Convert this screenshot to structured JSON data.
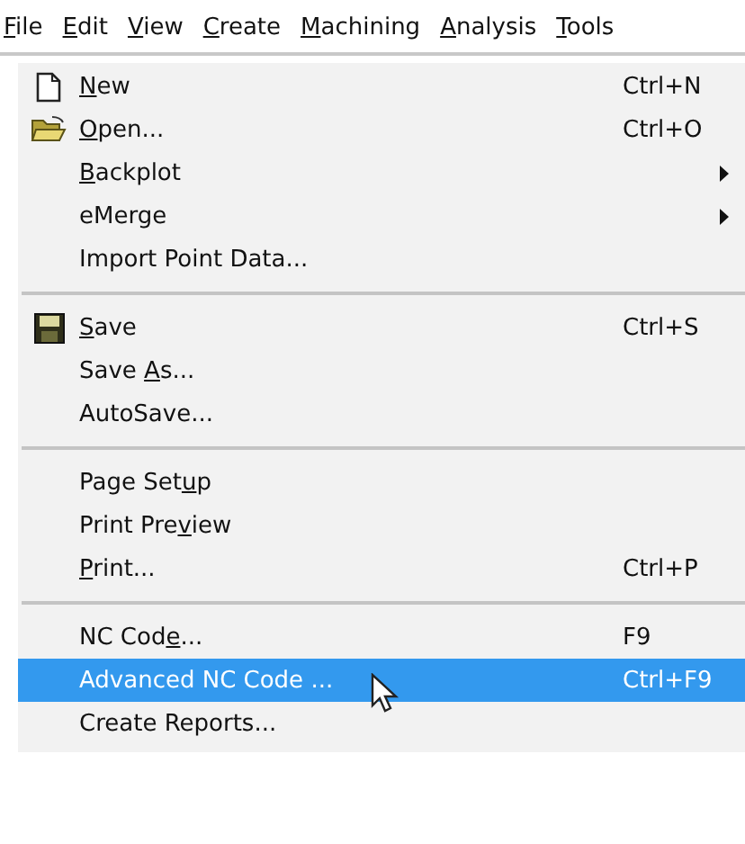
{
  "menubar": [
    {
      "label_parts": [
        {
          "text": "F",
          "underline": true
        },
        {
          "text": "ile",
          "underline": false
        }
      ]
    },
    {
      "label_parts": [
        {
          "text": "E",
          "underline": true
        },
        {
          "text": "dit",
          "underline": false
        }
      ]
    },
    {
      "label_parts": [
        {
          "text": "V",
          "underline": true
        },
        {
          "text": "iew",
          "underline": false
        }
      ]
    },
    {
      "label_parts": [
        {
          "text": "C",
          "underline": true
        },
        {
          "text": "reate",
          "underline": false
        }
      ]
    },
    {
      "label_parts": [
        {
          "text": "M",
          "underline": true
        },
        {
          "text": "achining",
          "underline": false
        }
      ]
    },
    {
      "label_parts": [
        {
          "text": "A",
          "underline": true
        },
        {
          "text": "nalysis",
          "underline": false
        }
      ]
    },
    {
      "label_parts": [
        {
          "text": "T",
          "underline": true
        },
        {
          "text": "ools",
          "underline": false
        }
      ]
    }
  ],
  "menu": [
    {
      "kind": "item",
      "label_parts": [
        {
          "text": "N",
          "underline": true
        },
        {
          "text": "ew",
          "underline": false
        }
      ],
      "shortcut": "Ctrl+N",
      "submenu": false,
      "selected": false
    },
    {
      "kind": "item",
      "label_parts": [
        {
          "text": "O",
          "underline": true
        },
        {
          "text": "pen...",
          "underline": false
        }
      ],
      "shortcut": "Ctrl+O",
      "submenu": false,
      "selected": false
    },
    {
      "kind": "item",
      "label_parts": [
        {
          "text": "B",
          "underline": true
        },
        {
          "text": "ackplot",
          "underline": false
        }
      ],
      "submenu": true,
      "selected": false
    },
    {
      "kind": "item",
      "label_parts": [
        {
          "text": "eMerge",
          "underline": false
        }
      ],
      "submenu": true,
      "selected": false
    },
    {
      "kind": "item",
      "label_parts": [
        {
          "text": "Import Point Data...",
          "underline": false
        }
      ],
      "submenu": false,
      "selected": false
    },
    {
      "kind": "separator"
    },
    {
      "kind": "item",
      "label_parts": [
        {
          "text": "S",
          "underline": true
        },
        {
          "text": "ave",
          "underline": false
        }
      ],
      "shortcut": "Ctrl+S",
      "submenu": false,
      "selected": false
    },
    {
      "kind": "item",
      "label_parts": [
        {
          "text": "Save ",
          "underline": false
        },
        {
          "text": "A",
          "underline": true
        },
        {
          "text": "s...",
          "underline": false
        }
      ],
      "submenu": false,
      "selected": false
    },
    {
      "kind": "item",
      "label_parts": [
        {
          "text": "AutoSave...",
          "underline": false
        }
      ],
      "submenu": false,
      "selected": false
    },
    {
      "kind": "separator"
    },
    {
      "kind": "item",
      "label_parts": [
        {
          "text": "Page Set",
          "underline": false
        },
        {
          "text": "u",
          "underline": true
        },
        {
          "text": "p",
          "underline": false
        }
      ],
      "submenu": false,
      "selected": false
    },
    {
      "kind": "item",
      "label_parts": [
        {
          "text": "Print Pre",
          "underline": false
        },
        {
          "text": "v",
          "underline": true
        },
        {
          "text": "iew",
          "underline": false
        }
      ],
      "submenu": false,
      "selected": false
    },
    {
      "kind": "item",
      "label_parts": [
        {
          "text": "P",
          "underline": true
        },
        {
          "text": "rint...",
          "underline": false
        }
      ],
      "shortcut": "Ctrl+P",
      "submenu": false,
      "selected": false
    },
    {
      "kind": "separator"
    },
    {
      "kind": "item",
      "label_parts": [
        {
          "text": "NC Cod",
          "underline": false
        },
        {
          "text": "e",
          "underline": true
        },
        {
          "text": "...",
          "underline": false
        }
      ],
      "shortcut": "F9",
      "submenu": false,
      "selected": false
    },
    {
      "kind": "item",
      "label_parts": [
        {
          "text": "Advanced NC Code ...",
          "underline": false
        }
      ],
      "shortcut": "Ctrl+F9",
      "submenu": false,
      "selected": true
    },
    {
      "kind": "item",
      "label_parts": [
        {
          "text": "Create Reports...",
          "underline": false
        }
      ],
      "submenu": false,
      "selected": false
    }
  ]
}
